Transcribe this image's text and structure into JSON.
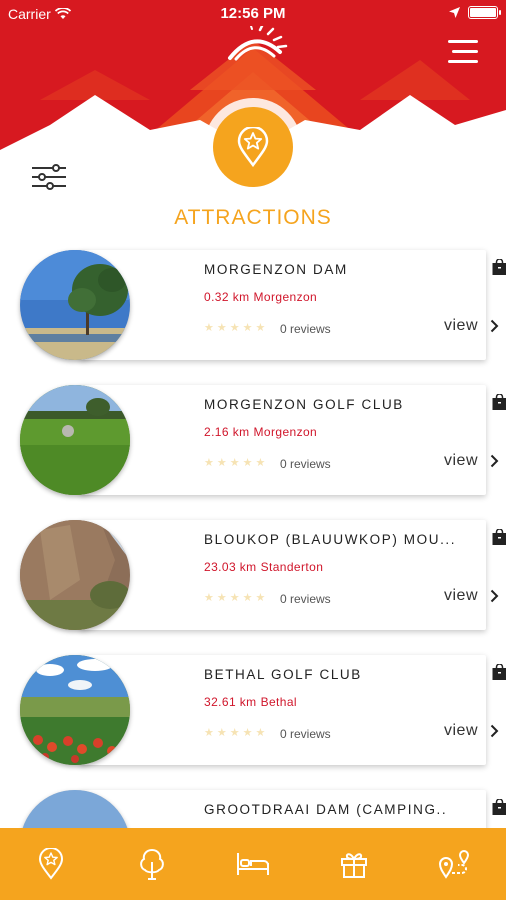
{
  "status_bar": {
    "carrier": "Carrier",
    "time": "12:56 PM"
  },
  "page": {
    "title": "ATTRACTIONS"
  },
  "colors": {
    "brand_red": "#D71920",
    "accent_orange": "#F5A41E",
    "distance_red": "#D0162B"
  },
  "icons": {
    "menu": "hamburger-menu-icon",
    "filter": "sliders-filter-icon",
    "header_pin": "map-pin-star-icon",
    "bag": "shopping-bag-icon",
    "chevron": "chevron-right-icon"
  },
  "attractions": [
    {
      "name": "MORGENZON DAM",
      "distance": "0.32 km",
      "town": "Morgenzon",
      "reviews": "0 reviews",
      "view_label": "view"
    },
    {
      "name": "MORGENZON GOLF CLUB",
      "distance": "2.16 km",
      "town": "Morgenzon",
      "reviews": "0 reviews",
      "view_label": "view"
    },
    {
      "name": "BLOUKOP (BLAUUWKOP) MOU...",
      "distance": "23.03 km",
      "town": "Standerton",
      "reviews": "0 reviews",
      "view_label": "view"
    },
    {
      "name": "BETHAL GOLF CLUB",
      "distance": "32.61 km",
      "town": "Bethal",
      "reviews": "0 reviews",
      "view_label": "view"
    },
    {
      "name": "GROOTDRAAI DAM (CAMPING..",
      "distance": "",
      "town": "",
      "reviews": "",
      "view_label": ""
    }
  ],
  "bottom_nav": [
    {
      "icon": "map-pin-star-icon"
    },
    {
      "icon": "tree-icon"
    },
    {
      "icon": "bed-icon"
    },
    {
      "icon": "gift-icon"
    },
    {
      "icon": "route-icon"
    }
  ]
}
